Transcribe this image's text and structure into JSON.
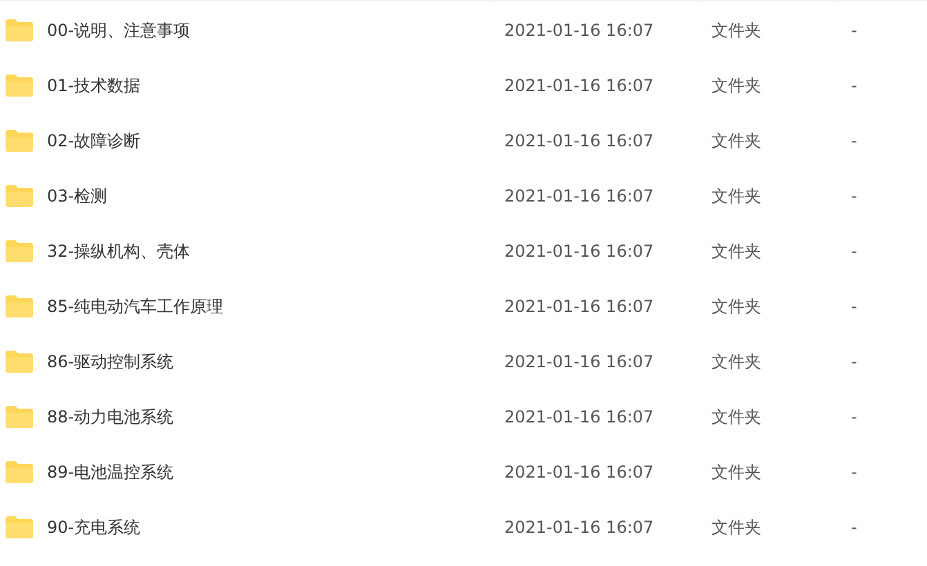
{
  "files": [
    {
      "name": "00-说明、注意事项",
      "modified": "2021-01-16 16:07",
      "type": "文件夹",
      "size": "-"
    },
    {
      "name": "01-技术数据",
      "modified": "2021-01-16 16:07",
      "type": "文件夹",
      "size": "-"
    },
    {
      "name": "02-故障诊断",
      "modified": "2021-01-16 16:07",
      "type": "文件夹",
      "size": "-"
    },
    {
      "name": "03-检测",
      "modified": "2021-01-16 16:07",
      "type": "文件夹",
      "size": "-"
    },
    {
      "name": "32-操纵机构、壳体",
      "modified": "2021-01-16 16:07",
      "type": "文件夹",
      "size": "-"
    },
    {
      "name": "85-纯电动汽车工作原理",
      "modified": "2021-01-16 16:07",
      "type": "文件夹",
      "size": "-"
    },
    {
      "name": "86-驱动控制系统",
      "modified": "2021-01-16 16:07",
      "type": "文件夹",
      "size": "-"
    },
    {
      "name": "88-动力电池系统",
      "modified": "2021-01-16 16:07",
      "type": "文件夹",
      "size": "-"
    },
    {
      "name": "89-电池温控系统",
      "modified": "2021-01-16 16:07",
      "type": "文件夹",
      "size": "-"
    },
    {
      "name": "90-充电系统",
      "modified": "2021-01-16 16:07",
      "type": "文件夹",
      "size": "-"
    }
  ]
}
